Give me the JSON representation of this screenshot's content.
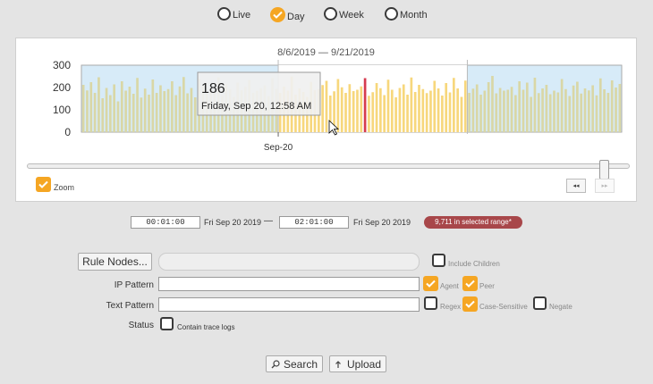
{
  "view_modes": [
    {
      "label": "Live",
      "selected": false
    },
    {
      "label": "Day",
      "selected": true
    },
    {
      "label": "Week",
      "selected": false
    },
    {
      "label": "Month",
      "selected": false
    }
  ],
  "colors": {
    "accent": "#f5a623",
    "bar_default": "#d9d7a6",
    "bar_selected": "#f7d77c",
    "bar_highlight": "#d63b50",
    "plot_bg": "#d7ebf8",
    "badge": "#a8474a"
  },
  "chart_data": {
    "type": "bar",
    "title": "8/6/2019 — 9/21/2019",
    "ylim": [
      0,
      300
    ],
    "yticks": [
      0,
      100,
      200,
      300
    ],
    "xtick_labels": [
      "Sep-20"
    ],
    "values": [
      212,
      187,
      224,
      176,
      246,
      152,
      198,
      166,
      214,
      138,
      228,
      186,
      204,
      172,
      243,
      155,
      195,
      168,
      236,
      176,
      210,
      184,
      193,
      228,
      166,
      205,
      247,
      174,
      198,
      156,
      238,
      206,
      172,
      196,
      182,
      246,
      164,
      215,
      192,
      158,
      222,
      188,
      203,
      234,
      176,
      185,
      197,
      210,
      162,
      242,
      194,
      176,
      204,
      186,
      249,
      168,
      196,
      180,
      158,
      225,
      188,
      193,
      211,
      230,
      164,
      183,
      238,
      201,
      176,
      215,
      184,
      190,
      205,
      242,
      163,
      179,
      220,
      197,
      166,
      235,
      190,
      156,
      198,
      214,
      168,
      245,
      180,
      212,
      193,
      175,
      186,
      230,
      196,
      164,
      220,
      178,
      243,
      196,
      158,
      231,
      176,
      195,
      214,
      168,
      186,
      224,
      252,
      174,
      198,
      186,
      190,
      203,
      166,
      228,
      190,
      222,
      158,
      244,
      175,
      196,
      212,
      170,
      186,
      178,
      238,
      193,
      162,
      209,
      226,
      173,
      196,
      187,
      210,
      165,
      241,
      192,
      176,
      232,
      200,
      216
    ],
    "selected_range": [
      51,
      99
    ],
    "highlight_index": 73,
    "tooltip": {
      "value": "186",
      "label": "Friday, Sep 20, 12:58 AM"
    }
  },
  "zoom": {
    "label": "Zoom",
    "checked": true
  },
  "nav": {
    "back": "◂◂",
    "forward": "▸▸"
  },
  "time_range": {
    "start_time": "00:01:00",
    "start_date": "Fri Sep 20 2019",
    "separator": "—",
    "end_time": "02:01:00",
    "end_date": "Fri Sep 20 2019",
    "count_badge": "9,711 in selected range*"
  },
  "form": {
    "rule_nodes_button": "Rule Nodes...",
    "include_children": "Include Children",
    "ip_pattern_label": "IP Pattern",
    "agent_label": "Agent",
    "peer_label": "Peer",
    "text_pattern_label": "Text Pattern",
    "regex_label": "Regex",
    "case_sensitive_label": "Case-Sensitive",
    "negate_label": "Negate",
    "status_label": "Status",
    "contain_trace_logs": "Contain trace logs"
  },
  "actions": {
    "search_label": "Search",
    "search_icon": "magnifier-icon",
    "upload_label": "Upload",
    "upload_icon": "up-arrow-icon"
  }
}
